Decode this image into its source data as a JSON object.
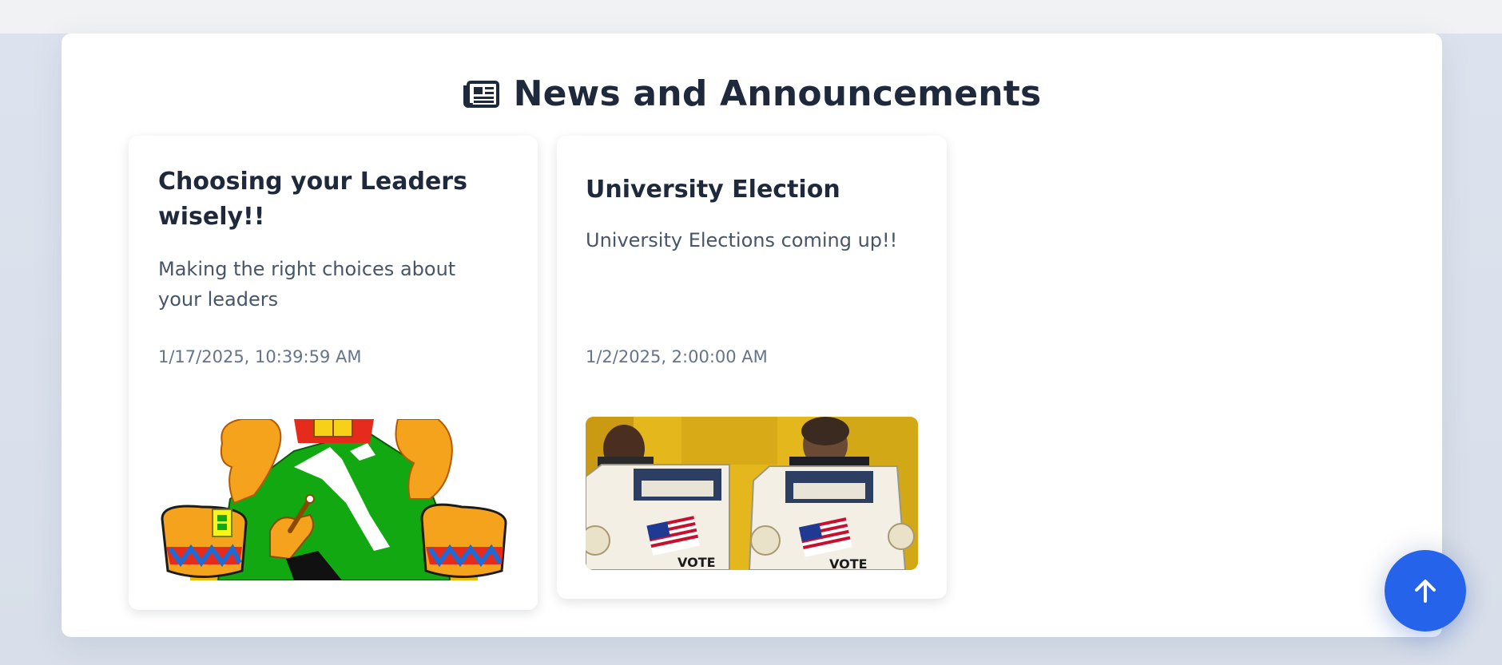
{
  "section": {
    "icon": "newspaper-icon",
    "title": "News and Announcements"
  },
  "news": [
    {
      "title": "Choosing your Leaders wisely!!",
      "description": "Making the right choices about your leaders",
      "date": "1/17/2025, 10:39:59 AM",
      "image": "coat-of-arms-emblem"
    },
    {
      "title": "University Election",
      "description": "University Elections coming up!!",
      "date": "1/2/2025, 2:00:00 AM",
      "image": "voting-booth-photo",
      "image_text": "VOTE"
    }
  ],
  "scroll_top": {
    "icon": "arrow-up-icon"
  },
  "colors": {
    "accent": "#2563eb",
    "heading": "#1e293b",
    "body_text": "#475569",
    "muted_text": "#64748b"
  }
}
